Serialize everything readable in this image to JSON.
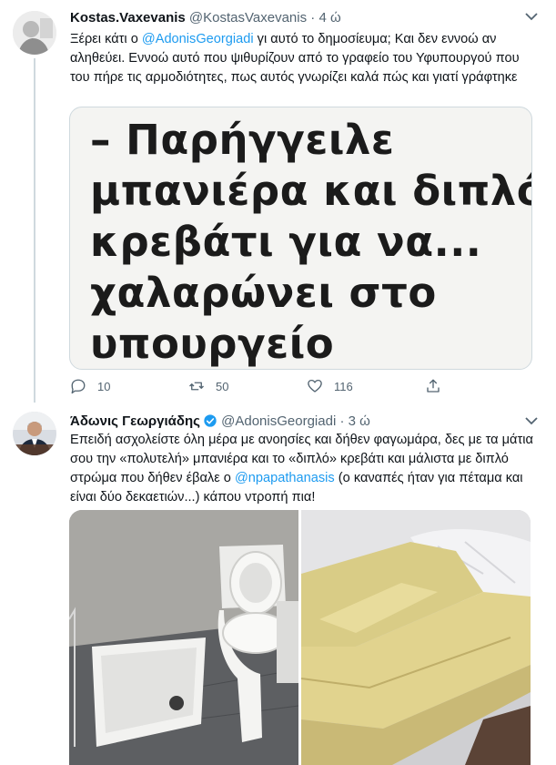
{
  "tweet1": {
    "name": "Kostas.Vaxevanis",
    "handle": "@KostasVaxevanis",
    "time": "4 ώ",
    "text_before": "Ξέρει κάτι ο ",
    "mention": "@AdonisGeorgiadi",
    "text_after": " γι αυτό το δημοσίευμα; Και δεν εννοώ αν αληθεύει. Εννοώ αυτό που ψιθυρίζουν από το γραφείο του Υφυπουργού που του πήρε τις αρμοδιότητες, πως αυτός γνωρίζει καλά πώς και γιατί γράφτηκε",
    "image_lines": [
      "– Παρήγγειλε",
      "μπανιέρα και διπλό",
      "κρεβάτι για να...",
      "χαλαρώνει στο",
      "υπουργείο"
    ],
    "replies": "10",
    "retweets": "50",
    "likes": "116"
  },
  "tweet2": {
    "name": "Άδωνις Γεωργιάδης",
    "handle": "@AdonisGeorgiadi",
    "time": "3 ώ",
    "text_before": "Επειδή ασχολείστε όλη μέρα με ανοησίες και δήθεν φαγωμάρα, δες με τα μάτια σου την «πολυτελή» μπανιέρα και το «διπλό» κρεβάτι και μάλιστα με διπλό στρώμα που δήθεν έβαλε ο ",
    "mention": "@npapathanasis",
    "text_after": " (ο καναπές ήταν για πέταμα και είναι δύο δεκαετιών...) κάπου ντροπή πια!"
  },
  "colors": {
    "accent": "#1d9bf0",
    "secondary_text": "#536471",
    "border": "#cfd9de"
  },
  "icons": {
    "reply": "reply-icon",
    "retweet": "retweet-icon",
    "like": "heart-icon",
    "share": "share-icon",
    "more": "chevron-down-icon",
    "verified": "verified-badge-icon"
  }
}
